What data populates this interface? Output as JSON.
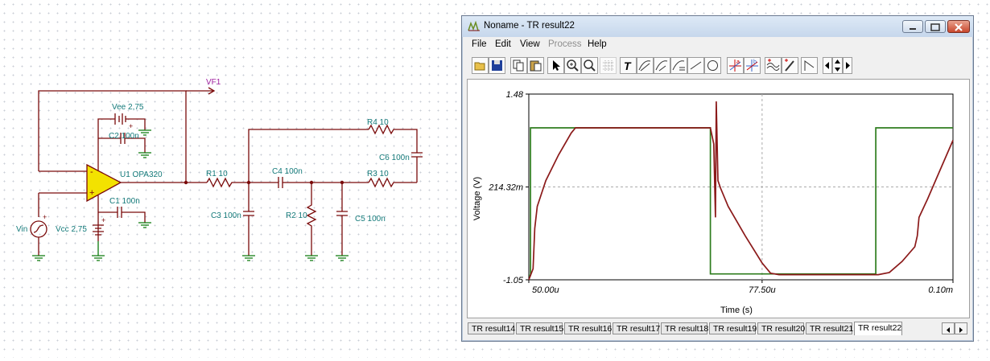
{
  "schematic": {
    "labels": {
      "vf1": "VF1",
      "vee": "Vee 2,75",
      "c2": "C2 100n",
      "u1": "U1 OPA320",
      "c1": "C1 100n",
      "vin": "Vin",
      "vcc": "Vcc 2,75",
      "r1": "R1 10",
      "c3": "C3 100n",
      "c4": "C4 100n",
      "r2": "R2 10",
      "c5": "C5 100n",
      "r3": "R3 10",
      "r4": "R4 10",
      "c6": "C6 100n"
    },
    "plus": "+",
    "minus": "-"
  },
  "window": {
    "title": "Noname - TR result22",
    "menu": {
      "file": "File",
      "edit": "Edit",
      "view": "View",
      "process": "Process",
      "help": "Help"
    },
    "toolbar_icons": [
      "open-icon",
      "save-icon",
      "copy-icon",
      "paste-icon",
      "pointer-icon",
      "zoom-in-icon",
      "zoom-100-icon",
      "grid-icon",
      "text-icon",
      "curve-edit-icon",
      "curve-edit2-icon",
      "curve-label-icon",
      "line-icon",
      "circle-icon",
      "cursor-a-icon",
      "cursor-b-icon",
      "waves-icon",
      "probe-icon",
      "signal-icon",
      "scroll-left-icon",
      "scroll-updown-icon",
      "scroll-right-icon"
    ],
    "tabs": [
      "TR result14",
      "TR result15",
      "TR result16",
      "TR result17",
      "TR result18",
      "TR result19",
      "TR result20",
      "TR result21",
      "TR result22"
    ],
    "active_tab": "TR result22"
  },
  "chart_data": {
    "type": "line",
    "xlabel": "Time (s)",
    "ylabel": "Voltage (V)",
    "x_tick_labels": [
      "50.00u",
      "77.50u",
      "0.10m"
    ],
    "y_tick_labels": [
      "1.48",
      "214.32m",
      "-1.05"
    ],
    "xlim": [
      5e-05,
      0.0001
    ],
    "ylim": [
      -1.05,
      1.48
    ],
    "grid": "dashed at middle ticks",
    "colors": {
      "input": "#2e7d1e",
      "output": "#8b1a1a"
    },
    "series": [
      {
        "color": "#2e7d1e",
        "x": [
          5e-05,
          5.02e-05,
          5.02e-05,
          7.14e-05,
          7.14e-05,
          9.09e-05,
          9.09e-05,
          0.0001
        ],
        "y": [
          -0.99,
          -0.99,
          1.02,
          1.02,
          -0.97,
          -0.97,
          1.02,
          1.02
        ]
      },
      {
        "color": "#8b1a1a",
        "x": [
          5e-05,
          5.05e-05,
          5.07e-05,
          5.1e-05,
          5.2e-05,
          5.35e-05,
          5.5e-05,
          5.55e-05,
          5.6e-05,
          7.14e-05,
          7.18e-05,
          7.2e-05,
          7.21e-05,
          7.23e-05,
          7.26e-05,
          7.35e-05,
          7.55e-05,
          7.75e-05,
          7.85e-05,
          7.95e-05,
          9.09e-05,
          9.12e-05,
          9.25e-05,
          9.4e-05,
          9.55e-05,
          9.58e-05,
          9.6e-05,
          9.7e-05,
          9.85e-05,
          0.0001
        ],
        "y": [
          -1.05,
          -0.9,
          -0.35,
          -0.05,
          0.3,
          0.65,
          0.95,
          1.02,
          1.02,
          1.02,
          0.8,
          -0.2,
          1.38,
          0.3,
          0.2,
          -0.05,
          -0.45,
          -0.82,
          -0.96,
          -0.98,
          -0.98,
          -0.98,
          -0.95,
          -0.8,
          -0.6,
          -0.45,
          -0.2,
          0.05,
          0.45,
          0.85
        ]
      }
    ]
  }
}
